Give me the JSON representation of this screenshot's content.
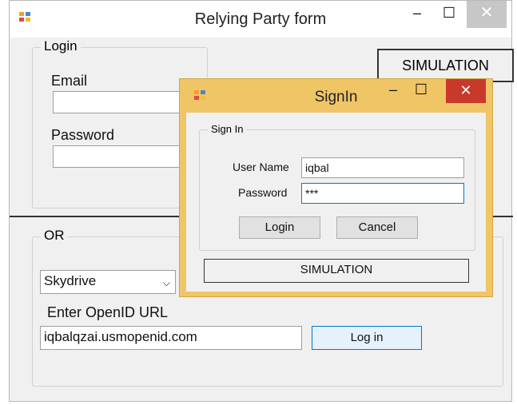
{
  "main": {
    "title": "Relying Party form",
    "minimize": "–",
    "maximize": "☐",
    "close": "✕",
    "simulation_button": "SIMULATION",
    "login_group": {
      "legend": "Login",
      "email_label": "Email",
      "email_value": "",
      "password_label": "Password",
      "password_value": ""
    },
    "or_group": {
      "legend": "OR",
      "provider_selected": "Skydrive",
      "openid_label": "Enter OpenID URL",
      "openid_value": "iqbalqzai.usmopenid.com",
      "login_button": "Log in"
    }
  },
  "dialog": {
    "title": "SignIn",
    "minimize": "–",
    "maximize": "☐",
    "close": "✕",
    "group_legend": "Sign In",
    "username_label": "User Name",
    "username_value": "iqbal",
    "password_label": "Password",
    "password_value": "***",
    "login_button": "Login",
    "cancel_button": "Cancel",
    "simulation_button": "SIMULATION"
  },
  "colors": {
    "dialog_frame": "#f0c566",
    "close_red": "#c8392b",
    "focus_blue": "#0078d7"
  },
  "icons": [
    "app-icon",
    "dropdown-chevron-icon"
  ]
}
